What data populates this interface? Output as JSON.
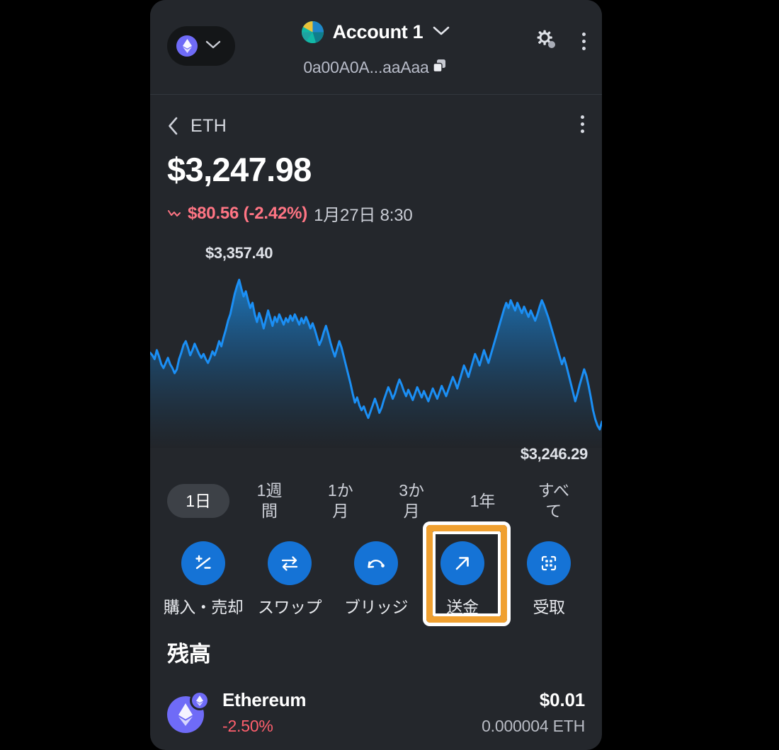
{
  "header": {
    "network_selector": {
      "name": "network-selector",
      "icon": "ethereum-logo-icon",
      "chevron": "chevron-down-icon"
    },
    "account_name": "Account 1",
    "account_chevron": "chevron-down-icon",
    "address": "0a00A0A...aaAaa",
    "copy_icon": "copy-icon",
    "globe_icon": "network-status-icon",
    "menu_icon": "kebab-menu-icon"
  },
  "asset": {
    "back_icon": "back-chevron-icon",
    "symbol": "ETH",
    "menu_icon": "kebab-menu-icon",
    "price": "$3,247.98",
    "trend_icon": "trend-down-icon",
    "change_amount": "$80.56 (-2.42%)",
    "change_time": "1月27日 8:30",
    "change_color": "#ff7584"
  },
  "chart_data": {
    "type": "line",
    "title": "",
    "xlabel": "",
    "ylabel": "",
    "max_label": "$3,357.40",
    "min_label": "$3,246.29",
    "ylim": [
      3230,
      3365
    ],
    "line_color": "#1b8ff5",
    "fill_gradient": [
      "#1b6fae",
      "#1d2126"
    ],
    "grid": false,
    "legend": null,
    "values": [
      3300,
      3298,
      3295,
      3302,
      3297,
      3291,
      3288,
      3292,
      3296,
      3291,
      3288,
      3284,
      3287,
      3295,
      3300,
      3306,
      3309,
      3304,
      3298,
      3302,
      3307,
      3303,
      3299,
      3296,
      3299,
      3295,
      3292,
      3296,
      3301,
      3298,
      3303,
      3309,
      3305,
      3312,
      3318,
      3325,
      3330,
      3338,
      3346,
      3352,
      3357,
      3350,
      3344,
      3348,
      3341,
      3335,
      3339,
      3330,
      3324,
      3331,
      3326,
      3319,
      3326,
      3333,
      3327,
      3321,
      3328,
      3324,
      3330,
      3326,
      3322,
      3327,
      3324,
      3329,
      3325,
      3330,
      3326,
      3322,
      3327,
      3323,
      3328,
      3324,
      3319,
      3323,
      3318,
      3312,
      3306,
      3310,
      3316,
      3321,
      3315,
      3308,
      3302,
      3297,
      3303,
      3309,
      3304,
      3297,
      3290,
      3283,
      3276,
      3268,
      3261,
      3265,
      3259,
      3255,
      3258,
      3253,
      3249,
      3254,
      3259,
      3264,
      3259,
      3253,
      3257,
      3263,
      3268,
      3273,
      3269,
      3264,
      3268,
      3274,
      3279,
      3275,
      3270,
      3266,
      3271,
      3267,
      3263,
      3268,
      3273,
      3269,
      3265,
      3270,
      3266,
      3262,
      3267,
      3272,
      3268,
      3264,
      3269,
      3274,
      3270,
      3266,
      3271,
      3276,
      3281,
      3277,
      3272,
      3278,
      3284,
      3290,
      3286,
      3281,
      3287,
      3293,
      3299,
      3295,
      3290,
      3296,
      3302,
      3297,
      3292,
      3298,
      3304,
      3310,
      3316,
      3322,
      3328,
      3334,
      3339,
      3335,
      3341,
      3337,
      3333,
      3339,
      3335,
      3331,
      3336,
      3332,
      3328,
      3333,
      3329,
      3325,
      3330,
      3336,
      3341,
      3337,
      3332,
      3327,
      3321,
      3315,
      3309,
      3303,
      3297,
      3291,
      3296,
      3290,
      3283,
      3276,
      3269,
      3262,
      3268,
      3275,
      3281,
      3287,
      3282,
      3274,
      3265,
      3255,
      3248,
      3243,
      3240,
      3246
    ]
  },
  "ranges": {
    "items": [
      {
        "label": "1日",
        "selected": true
      },
      {
        "label": "1週間",
        "selected": false
      },
      {
        "label": "1か月",
        "selected": false
      },
      {
        "label": "3か月",
        "selected": false
      },
      {
        "label": "1年",
        "selected": false
      },
      {
        "label": "すべて",
        "selected": false
      }
    ]
  },
  "actions": {
    "items": [
      {
        "label": "購入・売却",
        "icon": "plus-minus-icon",
        "highlighted": false
      },
      {
        "label": "スワップ",
        "icon": "swap-arrows-icon",
        "highlighted": false
      },
      {
        "label": "ブリッジ",
        "icon": "bridge-arc-icon",
        "highlighted": false
      },
      {
        "label": "送金",
        "icon": "arrow-up-right-icon",
        "highlighted": true
      },
      {
        "label": "受取",
        "icon": "qr-scan-icon",
        "highlighted": false
      }
    ],
    "button_color": "#1573d6",
    "highlight_color": "#f0a030"
  },
  "balance": {
    "title": "残高",
    "token": {
      "icon": "ethereum-token-icon",
      "badge_icon": "ethereum-network-badge-icon",
      "name": "Ethereum",
      "change": "-2.50%",
      "change_color": "#ff5f6d",
      "fiat_value": "$0.01",
      "token_amount": "0.000004 ETH"
    }
  },
  "annotation": {
    "arrow": "curved-pointer-arrow",
    "color": "#f0a030"
  }
}
